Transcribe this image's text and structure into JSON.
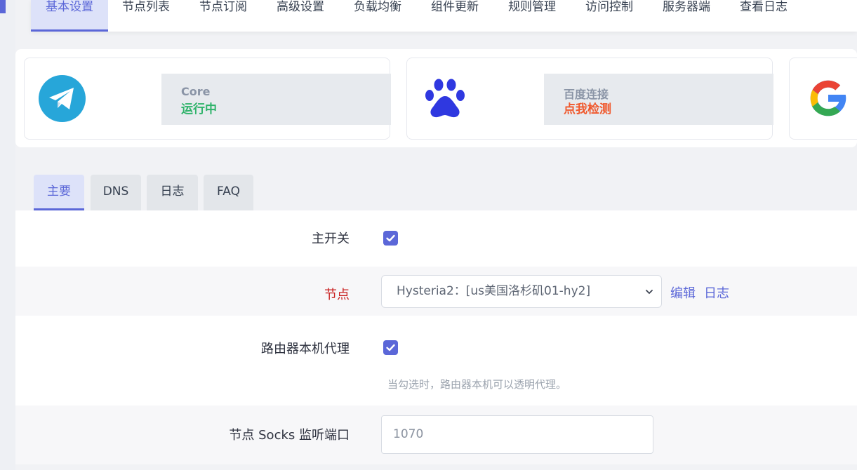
{
  "topnav": {
    "tabs": [
      {
        "label": "基本设置",
        "active": true
      },
      {
        "label": "节点列表"
      },
      {
        "label": "节点订阅"
      },
      {
        "label": "高级设置"
      },
      {
        "label": "负载均衡"
      },
      {
        "label": "组件更新"
      },
      {
        "label": "规则管理"
      },
      {
        "label": "访问控制"
      },
      {
        "label": "服务器端"
      },
      {
        "label": "查看日志"
      }
    ]
  },
  "status_cards": [
    {
      "icon": "telegram-icon",
      "title": "Core",
      "status": "运行中",
      "status_color": "#2fb36a"
    },
    {
      "icon": "baidu-paw-icon",
      "title": "百度连接",
      "status": "点我检测",
      "status_color": "#f0582c"
    },
    {
      "icon": "google-icon"
    }
  ],
  "subtabs": [
    {
      "label": "主要",
      "active": true
    },
    {
      "label": "DNS"
    },
    {
      "label": "日志"
    },
    {
      "label": "FAQ"
    }
  ],
  "form": {
    "main_switch": {
      "label": "主开关",
      "checked": true
    },
    "node": {
      "label": "节点",
      "value": "Hysteria2：[us美国洛杉矶01-hy2]",
      "edit_link": "编辑",
      "log_link": "日志"
    },
    "router_proxy": {
      "label": "路由器本机代理",
      "checked": true,
      "hint": "当勾选时，路由器本机可以透明代理。"
    },
    "socks_port": {
      "label": "节点 Socks 监听端口",
      "placeholder": "1070"
    }
  },
  "colors": {
    "accent": "#5b67d8",
    "required_label": "#c81e1e"
  }
}
